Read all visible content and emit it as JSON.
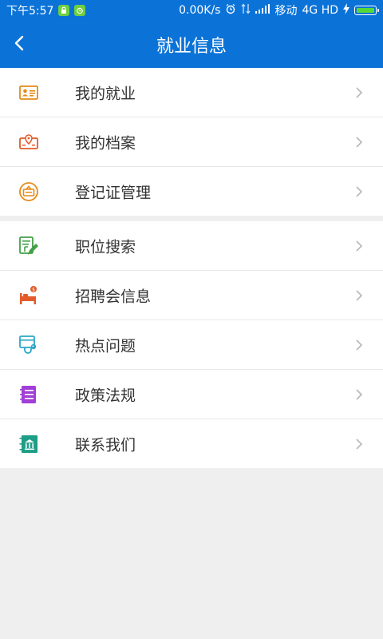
{
  "status": {
    "time": "下午5:57",
    "speed": "0.00K/s",
    "carrier": "移动",
    "network": "4G HD",
    "bar_color": "#0b73d8",
    "battery_color": "#56d83a"
  },
  "header": {
    "title": "就业信息",
    "back_icon": "chevron-left-icon"
  },
  "groups": [
    {
      "items": [
        {
          "label": "我的就业",
          "icon": "id-card-icon",
          "color": "#e58a17"
        },
        {
          "label": "我的档案",
          "icon": "map-pin-card-icon",
          "color": "#e35b2a"
        },
        {
          "label": "登记证管理",
          "icon": "certificate-badge-icon",
          "color": "#e58a17"
        }
      ]
    },
    {
      "items": [
        {
          "label": "职位搜索",
          "icon": "document-edit-icon",
          "color": "#43a047"
        },
        {
          "label": "招聘会信息",
          "icon": "bed-dollar-icon",
          "color": "#e35b2a"
        },
        {
          "label": "热点问题",
          "icon": "stethoscope-doc-icon",
          "color": "#2aa8c6"
        },
        {
          "label": "政策法规",
          "icon": "list-book-icon",
          "color": "#a23fd6"
        },
        {
          "label": "联系我们",
          "icon": "bank-book-icon",
          "color": "#1e9e86"
        }
      ]
    }
  ]
}
